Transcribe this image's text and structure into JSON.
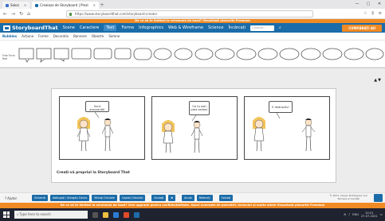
{
  "browser": {
    "tabs": [
      {
        "label": "Sakai",
        "active": false
      },
      {
        "label": "Crealaza de Storyboard | Prezi",
        "active": true
      }
    ],
    "url": "https://www.storyboardthat.com/storyboard-creator",
    "window_controls": [
      "—",
      "▢",
      "✕"
    ]
  },
  "promo_top": "De ce să te limitezi la versiunea de bază? Vizualizați planurile Premium",
  "site": {
    "logo": "StoryboardThat",
    "nav": [
      {
        "label": "Scene",
        "active": false
      },
      {
        "label": "Caractere",
        "active": false
      },
      {
        "label": "Text",
        "active": true
      },
      {
        "label": "Forme",
        "active": false
      },
      {
        "label": "Infographics",
        "active": false
      },
      {
        "label": "Web & Wireframe",
        "active": false
      },
      {
        "label": "Science",
        "active": false
      },
      {
        "label": "Încărcați",
        "active": false
      }
    ],
    "search_placeholder": "Căutare...",
    "cta": "CUMPĂRAȚI AII"
  },
  "subtabs": [
    {
      "label": "Bubbles",
      "active": true
    },
    {
      "label": "Acțiune",
      "active": false
    },
    {
      "label": "Forme",
      "active": false
    },
    {
      "label": "Decorativ",
      "active": false
    },
    {
      "label": "Bannere",
      "active": false
    },
    {
      "label": "Obiecte",
      "active": false
    },
    {
      "label": "Semne",
      "active": false
    }
  ],
  "freeform_label": "Free Form Red",
  "cells": [
    {
      "text": "Sunt amuzantă!"
    },
    {
      "text": "Ce tu esti prea serios!"
    },
    {
      "text": "E distractiv!"
    }
  ],
  "caption": "Creați-vă propriul la Storyboard That",
  "toolbar": {
    "help": "Ajutor",
    "buttons": [
      "Schemă",
      "Adăugați / Ștergeți Celule",
      "Mutați Celulele",
      "Copiați Celulele",
      "Anulați",
      "✖",
      "Anula",
      "Refaceți",
      "Salvați"
    ],
    "copyright": "© 2021, Clever Prototypes, LLC\nTermeni și Condiții"
  },
  "promo_bottom": "De ce să te limitezi la versiunea de bază? Vezi upgrade pentru confidențialitate, tipuri avansate de povestiri, încărcări și multe altele Vizualizați planurile Premium",
  "taskbar": {
    "search_placeholder": "Type here to search",
    "lang": "ENG",
    "time": "10:21",
    "date": "27.07.2021"
  },
  "colors": {
    "brand_blue": "#1b6ca8",
    "promo_orange": "#f08a24"
  }
}
